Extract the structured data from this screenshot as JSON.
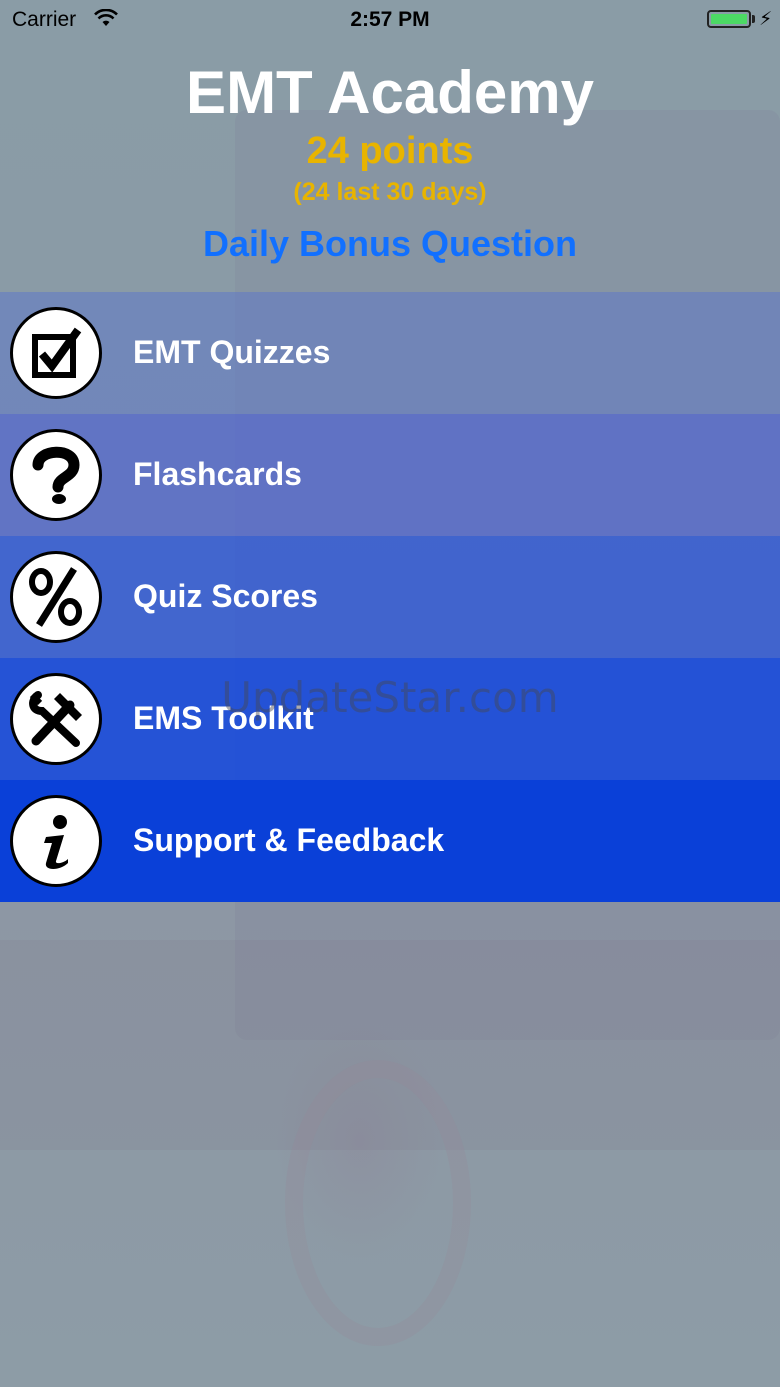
{
  "status_bar": {
    "carrier": "Carrier",
    "time": "2:57 PM",
    "battery_color": "#4cd964"
  },
  "header": {
    "title": "EMT Academy",
    "points": "24 points",
    "points_detail": "(24 last 30 days)",
    "bonus_link": "Daily Bonus Question"
  },
  "menu": {
    "items": [
      {
        "label": "EMT Quizzes",
        "icon": "checkbox-icon"
      },
      {
        "label": "Flashcards",
        "icon": "question-mark-icon"
      },
      {
        "label": "Quiz Scores",
        "icon": "percent-icon"
      },
      {
        "label": "EMS Toolkit",
        "icon": "tools-icon"
      },
      {
        "label": "Support & Feedback",
        "icon": "info-icon"
      }
    ]
  },
  "watermark": "UpdateStar.com",
  "colors": {
    "title": "#ffffff",
    "points": "#e8b400",
    "bonus": "#1170ff",
    "menu_last": "#0a40d8"
  }
}
